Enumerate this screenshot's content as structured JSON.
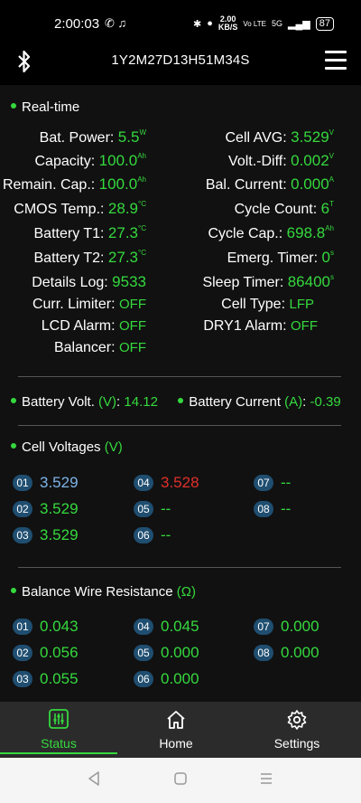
{
  "status_bar": {
    "time": "2:00:03",
    "speed_value": "2.00",
    "speed_unit": "KB/S",
    "network": "Vo LTE",
    "signal": "5G",
    "battery": "87"
  },
  "header": {
    "title": "1Y2M27D13H51M34S"
  },
  "realtime": {
    "section_title": "Real-time",
    "left": [
      {
        "label": "Bat. Power:",
        "value": "5.5",
        "unit": "W"
      },
      {
        "label": "Capacity:",
        "value": "100.0",
        "unit": "Ah"
      },
      {
        "label": "Remain. Cap.:",
        "value": "100.0",
        "unit": "Ah"
      },
      {
        "label": "CMOS Temp.:",
        "value": "28.9",
        "unit": "°C"
      },
      {
        "label": "Battery T1:",
        "value": "27.3",
        "unit": "°C"
      },
      {
        "label": "Battery T2:",
        "value": "27.3",
        "unit": "°C"
      },
      {
        "label": "Details Log:",
        "value": "9533",
        "unit": ""
      },
      {
        "label": "Curr. Limiter:",
        "value": "OFF",
        "unit": ""
      },
      {
        "label": "LCD Alarm:",
        "value": "OFF",
        "unit": ""
      },
      {
        "label": "Balancer:",
        "value": "OFF",
        "unit": ""
      }
    ],
    "right": [
      {
        "label": "Cell AVG:",
        "value": "3.529",
        "unit": "V"
      },
      {
        "label": "Volt.-Diff:",
        "value": "0.002",
        "unit": "V"
      },
      {
        "label": "Bal. Current:",
        "value": "0.000",
        "unit": "A"
      },
      {
        "label": "Cycle Count:",
        "value": "6",
        "unit": "T"
      },
      {
        "label": "Cycle Cap.:",
        "value": "698.8",
        "unit": "Ah"
      },
      {
        "label": "Emerg. Timer:",
        "value": "0",
        "unit": "s"
      },
      {
        "label": "Sleep Timer:",
        "value": "86400",
        "unit": "s"
      },
      {
        "label": "Cell Type:",
        "value": "LFP",
        "unit": ""
      },
      {
        "label": "DRY1 Alarm:",
        "value": "OFF",
        "unit": ""
      }
    ]
  },
  "battery_summary": {
    "volt_label": "Battery Volt.",
    "volt_unit": "(V)",
    "volt_value": "14.12",
    "current_label": "Battery Current",
    "current_unit": "(A)",
    "current_value": "-0.39"
  },
  "cell_voltages": {
    "section_title": "Cell Voltages",
    "unit": "(V)",
    "cells": [
      {
        "id": "01",
        "value": "3.529"
      },
      {
        "id": "02",
        "value": "3.529"
      },
      {
        "id": "03",
        "value": "3.529"
      },
      {
        "id": "04",
        "value": "3.528"
      },
      {
        "id": "05",
        "value": "--"
      },
      {
        "id": "06",
        "value": "--"
      },
      {
        "id": "07",
        "value": "--"
      },
      {
        "id": "08",
        "value": "--"
      }
    ]
  },
  "balance_wire": {
    "section_title": "Balance Wire Resistance",
    "unit": "(Ω)",
    "cells": [
      {
        "id": "01",
        "value": "0.043"
      },
      {
        "id": "02",
        "value": "0.056"
      },
      {
        "id": "03",
        "value": "0.055"
      },
      {
        "id": "04",
        "value": "0.045"
      },
      {
        "id": "05",
        "value": "0.000"
      },
      {
        "id": "06",
        "value": "0.000"
      },
      {
        "id": "07",
        "value": "0.000"
      },
      {
        "id": "08",
        "value": "0.000"
      }
    ]
  },
  "bottom_nav": {
    "items": [
      {
        "label": "Status",
        "icon": "sliders-icon",
        "active": true
      },
      {
        "label": "Home",
        "icon": "home-icon",
        "active": false
      },
      {
        "label": "Settings",
        "icon": "gear-icon",
        "active": false
      }
    ]
  },
  "colors": {
    "accent_green": "#35d93e",
    "value_red": "#e0302c",
    "value_blue": "#7eb4e8",
    "badge": "#1f4e70"
  }
}
